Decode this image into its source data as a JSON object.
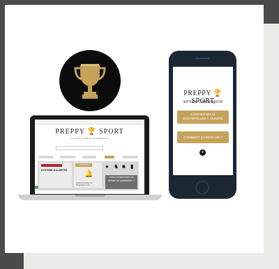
{
  "brand": {
    "name_left": "PREPPY",
    "name_right": "SPORT",
    "tagline": "service conciergerie",
    "colors": {
      "gold": "#c4a25a",
      "dark": "#1c2734",
      "black": "#0c0c0c"
    }
  },
  "trophy": {
    "icon": "trophy-icon"
  },
  "laptop": {
    "site_tagline": "le service de vente de vos équipements",
    "alert_title": "SYSTEME D'ALERTES",
    "label_gold": "NOUVEAU",
    "bell_caption_1": "système d'alerte sur",
    "bell_caption_2": "PreppySport.com",
    "request_text": "Vous recherchez un article en particulier ?"
  },
  "phone": {
    "button_sell_line1": "CONFIEZ-NOUS",
    "button_sell_line2": "VOS ARTICLES À VENDRE",
    "button_how": "COMMENT ÇA MARCHE ?"
  }
}
